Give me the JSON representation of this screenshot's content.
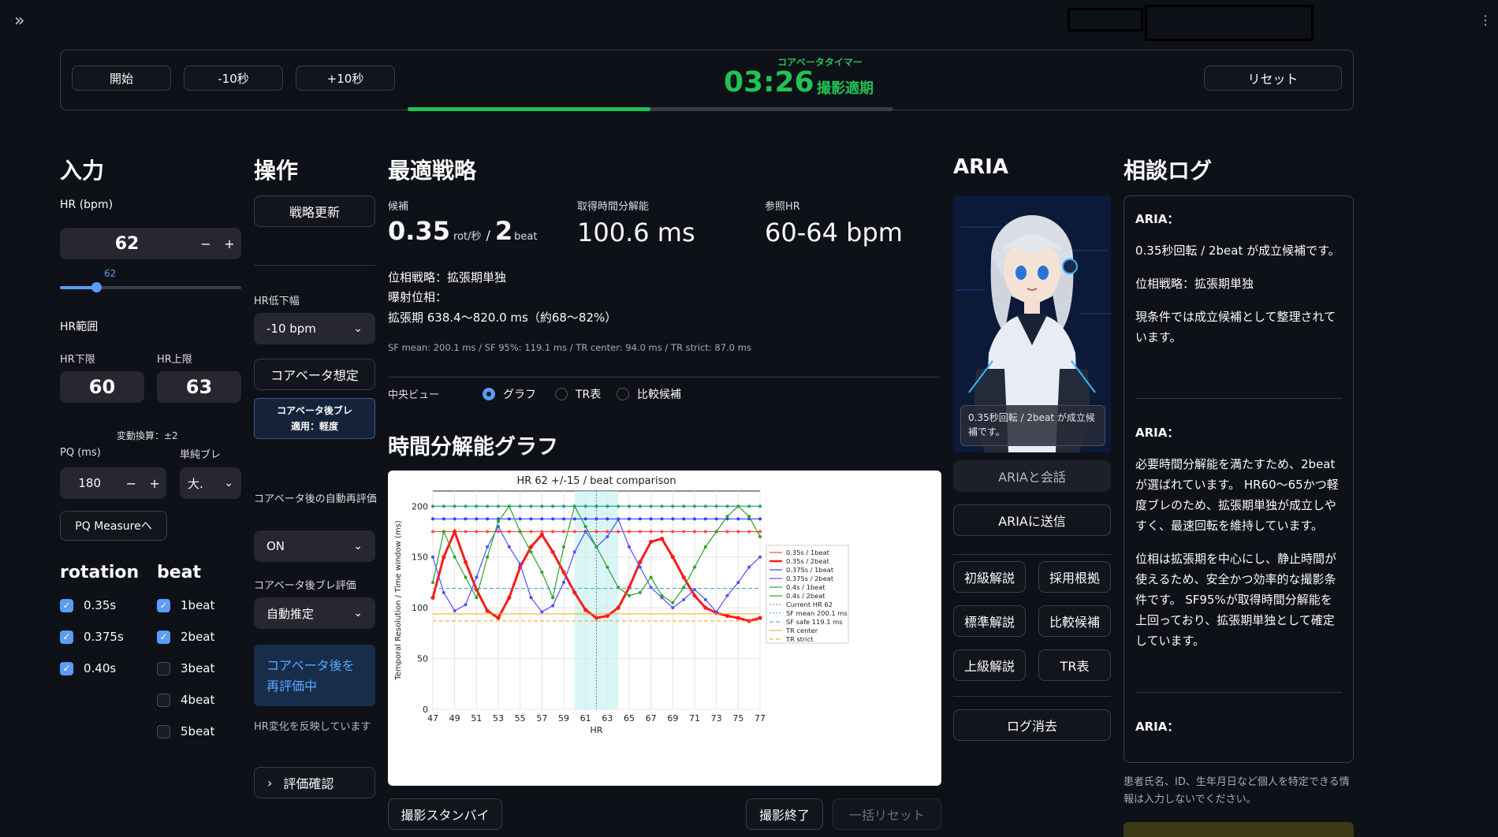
{
  "sidebar": {
    "expand_icon": "double-chevron-right-icon"
  },
  "menu": {
    "icon": "vertical-dots-icon"
  },
  "timer": {
    "start": "開始",
    "minus10": "-10秒",
    "plus10": "+10秒",
    "title": "コアベータタイマー",
    "time": "03:26",
    "status": "撮影適期",
    "reset": "リセット",
    "progress": 0.5,
    "accent": "#21c354"
  },
  "input": {
    "title": "入力",
    "hr_label": "HR (bpm)",
    "hr_value": "62",
    "minus": "−",
    "plus": "+",
    "slider_value": "62",
    "slider_fraction": 0.2,
    "range_label": "HR範囲",
    "lower_label": "HR下限",
    "upper_label": "HR上限",
    "lower_value": "60",
    "upper_value": "63",
    "variation": "変動換算：±2",
    "pq_label": "PQ (ms)",
    "pq_value": "180",
    "blur_label": "単純ブレ",
    "blur_value": "大.",
    "pq_button": "PQ Measureへ",
    "rotation_title": "rotation",
    "beat_title": "beat",
    "rotations": [
      {
        "label": "0.35s",
        "checked": true
      },
      {
        "label": "0.375s",
        "checked": true
      },
      {
        "label": "0.40s",
        "checked": true
      }
    ],
    "beats": [
      {
        "label": "1beat",
        "checked": true
      },
      {
        "label": "2beat",
        "checked": true
      },
      {
        "label": "3beat",
        "checked": false
      },
      {
        "label": "4beat",
        "checked": false
      },
      {
        "label": "5beat",
        "checked": false
      }
    ]
  },
  "ops": {
    "title": "操作",
    "update": "戦略更新",
    "hr_drop_label": "HR低下幅",
    "hr_drop_value": "-10 bpm",
    "assume": "コアベータ想定",
    "blur_badge_1": "コアベータ後ブレ",
    "blur_badge_2": "適用：軽度",
    "auto_label": "コアベータ後の自動再評価",
    "auto_value": "ON",
    "blur_eval_label": "コアベータ後ブレ評価",
    "blur_eval_value": "自動推定",
    "reeval_1": "コアベータ後を",
    "reeval_2": "再評価中",
    "hr_note": "HR変化を反映しています",
    "confirm": "評価確認"
  },
  "strategy": {
    "title": "最適戦略",
    "candidate_label": "候補",
    "candidate_rot": "0.35",
    "candidate_rot_unit": "rot/秒",
    "candidate_sep": "/",
    "candidate_beat": "2",
    "candidate_beat_unit": "beat",
    "time_res_label": "取得時間分解能",
    "time_res_value": "100.6 ms",
    "ref_hr_label": "参照HR",
    "ref_hr_value": "60-64 bpm",
    "phase": "位相戦略：拡張期単独",
    "exposure": "曝射位相：",
    "diastole": "拡張期 638.4〜820.0 ms（約68〜82%）",
    "sf_line": "SF mean: 200.1 ms / SF 95%: 119.1 ms / TR center: 94.0 ms / TR strict: 87.0 ms",
    "view_label": "中央ビュー",
    "views": [
      {
        "label": "グラフ",
        "on": true
      },
      {
        "label": "TR表",
        "on": false
      },
      {
        "label": "比較候補",
        "on": false
      }
    ],
    "graph_title": "時間分解能グラフ",
    "standby": "撮影スタンバイ",
    "end": "撮影終了",
    "batch_reset": "一括リセット"
  },
  "aria": {
    "title": "ARIA",
    "bubble": "0.35秒回転 / 2beat が成立候補です。",
    "talk": "ARIAと会話",
    "send": "ARIAに送信",
    "buttons": [
      "初級解説",
      "採用根拠",
      "標準解説",
      "比較候補",
      "上級解説",
      "TR表"
    ],
    "clear": "ログ消去"
  },
  "log": {
    "title": "相談ログ",
    "entries": [
      {
        "name": "ARIA：",
        "paras": [
          "0.35秒回転 / 2beat が成立候補です。",
          "位相戦略：拡張期単独",
          "現条件では成立候補として整理されています。"
        ]
      },
      {
        "name": "ARIA：",
        "paras": [
          "必要時間分解能を満たすため、2beatが選ばれています。 HR60〜65かつ軽度ブレのため、拡張期単独が成立しやすく、最速回転を維持しています。",
          "位相は拡張期を中心にし、静止時間が使えるため、安全かつ効率的な撮影条件です。 SF95%が取得時間分解能を上回っており、拡張期単独として確定しています。"
        ]
      },
      {
        "name": "ARIA：",
        "paras": []
      }
    ],
    "notice": "患者氏名、ID、生年月日など個人を特定できる情報は入力しないでください。"
  },
  "chart_data": {
    "type": "line",
    "title": "HR 62 +/-15 / beat comparison",
    "xlabel": "HR",
    "ylabel": "Temporal Resolution / Time window (ms)",
    "xlim": [
      47,
      77
    ],
    "ylim": [
      0,
      215
    ],
    "xticks": [
      47,
      49,
      51,
      53,
      55,
      57,
      59,
      61,
      63,
      65,
      67,
      69,
      71,
      73,
      75,
      77
    ],
    "yticks": [
      0,
      50,
      100,
      150,
      200
    ],
    "highlight_band": [
      60,
      64
    ],
    "current_hr": 62,
    "x": [
      47,
      48,
      49,
      50,
      51,
      52,
      53,
      54,
      55,
      56,
      57,
      58,
      59,
      60,
      61,
      62,
      63,
      64,
      65,
      66,
      67,
      68,
      69,
      70,
      71,
      72,
      73,
      74,
      75,
      76,
      77
    ],
    "series": [
      {
        "name": "0.35s / 1beat",
        "color": "#ff4b4b",
        "width": 1.2,
        "marker": true,
        "values": [
          175,
          175,
          175,
          175,
          175,
          175,
          175,
          175,
          175,
          175,
          175,
          175,
          175,
          175,
          175,
          175,
          175,
          175,
          175,
          175,
          175,
          175,
          175,
          175,
          175,
          175,
          175,
          175,
          175,
          175,
          175
        ]
      },
      {
        "name": "0.35s / 2beat",
        "color": "#ff1a1a",
        "width": 3,
        "marker": true,
        "values": [
          110,
          150,
          175,
          145,
          118,
          97,
          90,
          110,
          140,
          160,
          172,
          155,
          135,
          115,
          98,
          90,
          92,
          100,
          120,
          145,
          165,
          168,
          150,
          130,
          112,
          100,
          95,
          92,
          90,
          87,
          90
        ]
      },
      {
        "name": "0.375s / 1beat",
        "color": "#3040ff",
        "width": 1.2,
        "marker": true,
        "values": [
          187.5,
          187.5,
          187.5,
          187.5,
          187.5,
          187.5,
          187.5,
          187.5,
          187.5,
          187.5,
          187.5,
          187.5,
          187.5,
          187.5,
          187.5,
          187.5,
          187.5,
          187.5,
          187.5,
          187.5,
          187.5,
          187.5,
          187.5,
          187.5,
          187.5,
          187.5,
          187.5,
          187.5,
          187.5,
          187.5,
          187.5
        ]
      },
      {
        "name": "0.375s / 2beat",
        "color": "#5050ff",
        "width": 1.2,
        "marker": true,
        "values": [
          150,
          115,
          97,
          103,
          130,
          160,
          180,
          160,
          143,
          110,
          96,
          102,
          125,
          155,
          175,
          160,
          170,
          187,
          160,
          140,
          120,
          110,
          100,
          108,
          118,
          108,
          96,
          112,
          125,
          140,
          150
        ]
      },
      {
        "name": "0.4s / 1beat",
        "color": "#20a060",
        "width": 1.2,
        "marker": true,
        "values": [
          200,
          200,
          200,
          200,
          200,
          200,
          200,
          200,
          200,
          200,
          200,
          200,
          200,
          200,
          200,
          200,
          200,
          200,
          200,
          200,
          200,
          200,
          200,
          200,
          200,
          200,
          200,
          200,
          200,
          200,
          200
        ]
      },
      {
        "name": "0.4s / 2beat",
        "color": "#2ca02c",
        "width": 1.2,
        "marker": true,
        "values": [
          125,
          175,
          150,
          130,
          110,
          150,
          185,
          200,
          175,
          155,
          135,
          110,
          160,
          200,
          180,
          160,
          140,
          120,
          112,
          115,
          130,
          112,
          105,
          120,
          140,
          160,
          175,
          190,
          200,
          190,
          170
        ]
      },
      {
        "name": "Current HR 62",
        "color": "#7f7f7f",
        "width": 1,
        "dash": "dotted",
        "vertical": 62
      },
      {
        "name": "SF mean 200.1 ms",
        "color": "#2ea8d8",
        "width": 1,
        "dash": "dotted",
        "hline": 200.1
      },
      {
        "name": "SF safe 119.1 ms",
        "color": "#2ea8d8",
        "width": 1,
        "dash": "dashed",
        "hline": 119.1
      },
      {
        "name": "TR center",
        "color": "#ff9f1a",
        "width": 1,
        "dash": "solid",
        "hline": 94
      },
      {
        "name": "TR strict",
        "color": "#ff9f1a",
        "width": 1,
        "dash": "dashed",
        "hline": 87
      }
    ]
  }
}
